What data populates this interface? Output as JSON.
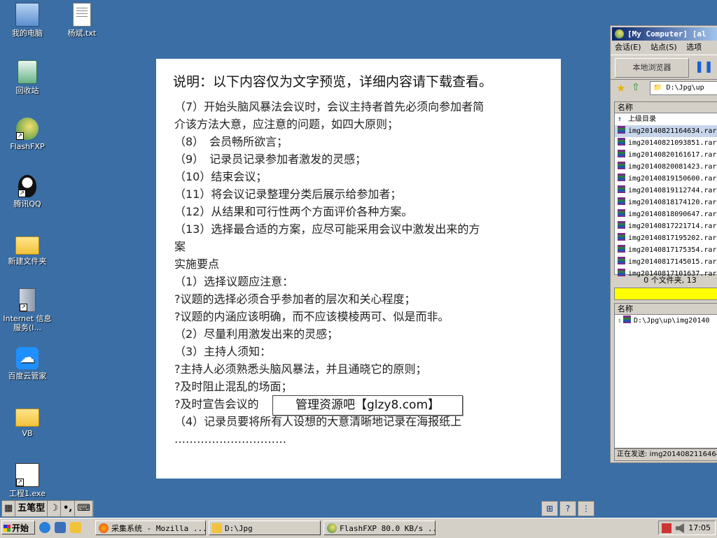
{
  "desktop_icons": [
    {
      "label": "我的电脑"
    },
    {
      "label": "杨斌.txt"
    },
    {
      "label": "回收站"
    },
    {
      "label": "FlashFXP"
    },
    {
      "label": "腾讯QQ"
    },
    {
      "label": "新建文件夹"
    },
    {
      "label": "Internet 信息服务(I..."
    },
    {
      "label": "百度云管家"
    },
    {
      "label": "VB"
    },
    {
      "label": "工程1.exe"
    }
  ],
  "preview": {
    "title": "说明：以下内容仅为文字预览，详细内容请下载查看。",
    "lines": [
      "（7）开始头脑风暴法会议时，会议主持者首先必须向参加者简",
      "介该方法大意，应注意的问题，如四大原则；",
      "（8）　会员畅所欲言；",
      "（9）　记录员记录参加者激发的灵感；",
      "（10）结束会议；",
      "（11）将会议记录整理分类后展示给参加者；",
      "（12）从结果和可行性两个方面评价各种方案。",
      "（13）选择最合适的方案，应尽可能采用会议中激发出来的方",
      "案",
      "实施要点",
      "（1）选择议题应注意：",
      "?议题的选择必须合乎参加者的层次和关心程度；",
      "?议题的内涵应该明确，而不应该模棱两可、似是而非。",
      "（2）尽量利用激发出来的灵感；",
      "（3）主持人须知：",
      "?主持人必须熟悉头脑风暴法，并且通晓它的原则；",
      "?及时阻止混乱的场面；",
      "?及时宣告会议的",
      "（4）记录员要将所有人设想的大意清晰地记录在海报纸上",
      "…………………………"
    ],
    "watermark": "管理资源吧【glzy8.com】"
  },
  "fxp": {
    "title": "[My Computer]  [al",
    "menu": [
      "会话(E)",
      "站点(S)",
      "选项"
    ],
    "local_browser": "本地浏览器",
    "path": "D:\\Jpg\\up",
    "col_name": "名称",
    "parent_dir": "上级目录",
    "files": [
      "img20140821164634.rar",
      "img20140821093851.rar",
      "img20140820161617.rar",
      "img20140820081423.rar",
      "img20140819150600.rar",
      "img20140819112744.rar",
      "img20140818174120.rar",
      "img20140818090647.rar",
      "img20140817221714.rar",
      "img20140817195202.rar",
      "img20140817175354.rar",
      "img20140817145015.rar",
      "img20140817101637.rar"
    ],
    "status": "0 个文件夹, 13",
    "queue_col": "名称",
    "queue_item": "D:\\Jpg\\up\\img20140",
    "bottom_status": "正在发送: img2014082116464"
  },
  "ime": {
    "mode": "五笔型"
  },
  "taskbar": {
    "start": "开始",
    "tasks": [
      "采集系统 - Mozilla ...",
      "D:\\Jpg",
      "FlashFXP 80.0 KB/s ..."
    ],
    "clock": "17:05"
  }
}
